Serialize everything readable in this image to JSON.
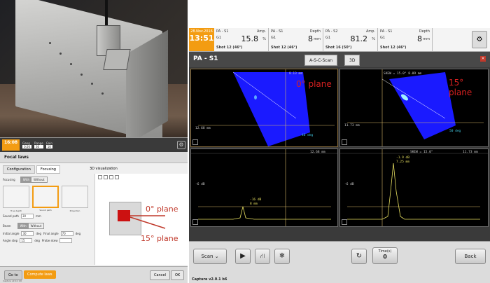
{
  "main": {
    "status": {
      "date": "28.Nov.2016",
      "time": "13:51",
      "readouts": [
        {
          "group": "PA - S1",
          "label": "G1",
          "label2": "Amp.",
          "value": "15.8",
          "unit": "%",
          "shot": "Shot 12 (46°)"
        },
        {
          "group": "PA - S1",
          "label": "G1",
          "label2": "Depth",
          "value": "8",
          "unit": "mm",
          "shot": "Shot 12 (46°)"
        },
        {
          "group": "PA - S2",
          "label": "G1",
          "label2": "Amp.",
          "value": "81.2",
          "unit": "%",
          "shot": "Shot 16 (50°)"
        },
        {
          "group": "PA - S1",
          "label": "G1",
          "label2": "Depth",
          "value": "8",
          "unit": "mm",
          "shot": "Shot 12 (46°)"
        }
      ]
    },
    "title": "PA - S1",
    "tabs": {
      "ascan": "A-S-C-Scan",
      "three_d": "3D"
    },
    "panels": {
      "sscan_left": {
        "top_label": "8.13 mm",
        "left_label": "12.68 mm",
        "angle_label": "46 deg",
        "plane": "0° plane"
      },
      "sscan_right": {
        "top_label": "SKEW = 15.0° 8.09 mm",
        "left_label": "11.73 mm",
        "angle_label": "50 deg",
        "plane": "15° plane"
      },
      "ascan_left": {
        "top_label": "12.68 mm",
        "db_label": "-6 dB",
        "peak_label": "-16 dB",
        "peak_depth": "8 mm"
      },
      "ascan_right": {
        "top_label": "SKEW = 15.0°",
        "top_label2": "11.73 mm",
        "db_label": "-6 dB",
        "peak_label": "-1.9 dB",
        "peak_depth": "7.25 mm"
      }
    },
    "bottom": {
      "scan": "Scan",
      "time_label": "Time(s)",
      "time_value": "0",
      "back": "Back",
      "capture": "Capture v2.0.1 b6"
    }
  },
  "left_app": {
    "clock": "16:08",
    "fields": [
      {
        "label": "Gang",
        "value": "0.00"
      },
      {
        "label": "Range",
        "value": "30"
      },
      {
        "label": "Gain",
        "value": "10"
      }
    ],
    "title": "Focal laws",
    "tabs": [
      "Configuration",
      "Focusing"
    ],
    "viz_title": "3D visualization",
    "focusing_label": "Focusing",
    "toggle_with": "With",
    "toggle_without": "Without",
    "thumbs": [
      "True depth",
      "Sound path",
      "Projection"
    ],
    "depth_label": "Sound path",
    "depth_value": "30",
    "depth_unit": "mm",
    "beam_label": "Beam",
    "rows": [
      {
        "label": "Initial angle",
        "value": "30",
        "unit": "deg",
        "label2": "Final angle",
        "value2": "70",
        "unit2": "deg"
      },
      {
        "label": "Angle step",
        "value": "15",
        "unit": "deg",
        "label2": "Probe skew",
        "value2": "",
        "unit2": ""
      }
    ],
    "plane_0": "0° plane",
    "plane_15": "15° plane",
    "footer": {
      "back": "Go to",
      "compute": "Compute laws",
      "cancel": "Cancel",
      "ok": "OK",
      "version": "Capture v2.0.1 b6"
    }
  }
}
